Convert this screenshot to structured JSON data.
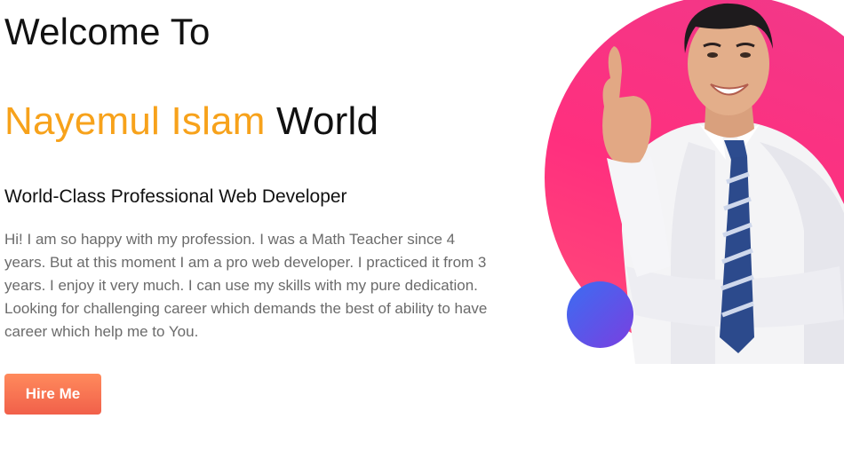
{
  "hero": {
    "welcome": "Welcome To",
    "name_accent": "Nayemul Islam",
    "name_rest": "World",
    "subtitle": "World-Class Professional Web Developer",
    "bio": "Hi! I am so happy with my profession. I was a Math Teacher since 4 years. But at this moment I am a pro web developer. I practiced it from 3 years. I enjoy it very much. I can use my skills with my pure dedication. Looking for challenging career which demands the best of ability to have career which help me to You.",
    "hire_label": "Hire Me"
  },
  "colors": {
    "accent": "#f7a21b",
    "button": "#f86a4e",
    "circle_pink": "#ff2f7e",
    "circle_blue": "#5a55e8"
  },
  "icons": {
    "portrait": "man-pointing-up-portrait"
  }
}
